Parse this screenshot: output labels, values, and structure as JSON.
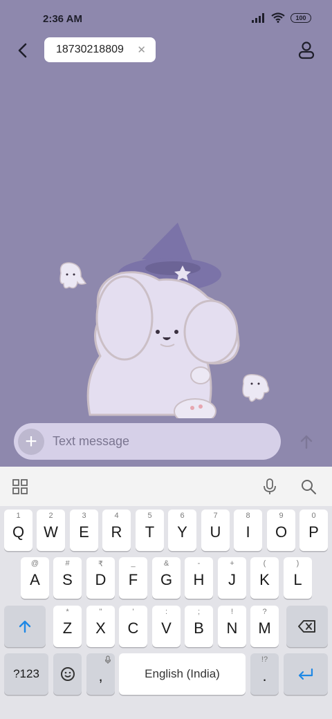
{
  "status_bar": {
    "time": "2:36 AM",
    "battery": "100"
  },
  "header": {
    "recipient": "18730218809"
  },
  "composer": {
    "placeholder": "Text message"
  },
  "keyboard": {
    "row1": [
      {
        "hint": "1",
        "key": "Q"
      },
      {
        "hint": "2",
        "key": "W"
      },
      {
        "hint": "3",
        "key": "E"
      },
      {
        "hint": "4",
        "key": "R"
      },
      {
        "hint": "5",
        "key": "T"
      },
      {
        "hint": "6",
        "key": "Y"
      },
      {
        "hint": "7",
        "key": "U"
      },
      {
        "hint": "8",
        "key": "I"
      },
      {
        "hint": "9",
        "key": "O"
      },
      {
        "hint": "0",
        "key": "P"
      }
    ],
    "row2": [
      {
        "hint": "@",
        "key": "A"
      },
      {
        "hint": "#",
        "key": "S"
      },
      {
        "hint": "₹",
        "key": "D"
      },
      {
        "hint": "_",
        "key": "F"
      },
      {
        "hint": "&",
        "key": "G"
      },
      {
        "hint": "-",
        "key": "H"
      },
      {
        "hint": "+",
        "key": "J"
      },
      {
        "hint": "(",
        "key": "K"
      },
      {
        "hint": ")",
        "key": "L"
      }
    ],
    "row3": [
      {
        "hint": "*",
        "key": "Z"
      },
      {
        "hint": "\"",
        "key": "X"
      },
      {
        "hint": "'",
        "key": "C"
      },
      {
        "hint": ":",
        "key": "V"
      },
      {
        "hint": ";",
        "key": "B"
      },
      {
        "hint": "!",
        "key": "N"
      },
      {
        "hint": "?",
        "key": "M"
      }
    ],
    "symbols_label": "?123",
    "comma": ",",
    "space_label": "English (India)",
    "period_hint": "!?",
    "period": "."
  },
  "icons": {
    "back": "back-arrow-icon",
    "contact": "contact-icon",
    "attach": "plus-icon",
    "send": "send-arrow-icon"
  }
}
